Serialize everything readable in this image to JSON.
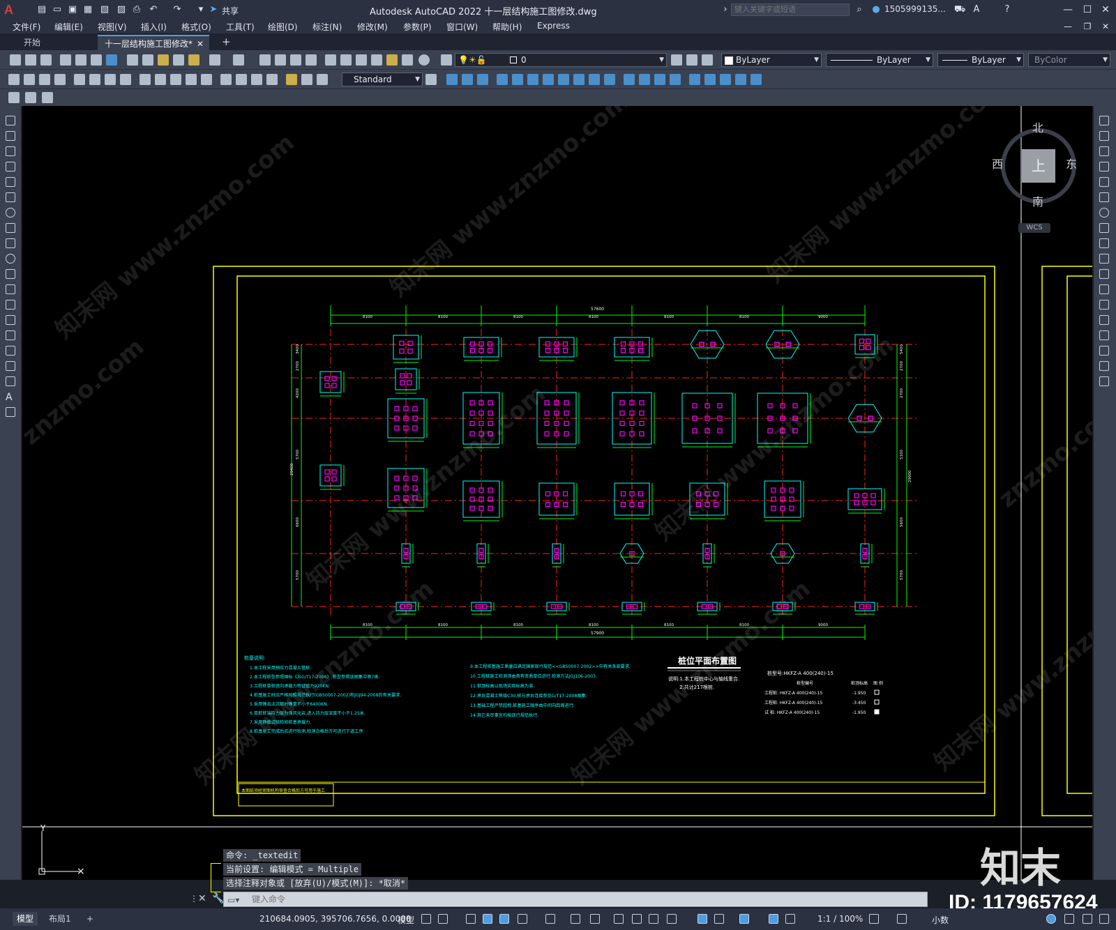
{
  "titlebar": {
    "app_logo": "A",
    "share_label": "共享",
    "title": "Autodesk AutoCAD 2022    十一层结构施工图修改.dwg",
    "search_placeholder": "键入关键字或短语",
    "user": "1505999135...",
    "icons": [
      "new-icon",
      "open-icon",
      "save-icon",
      "saveas-icon",
      "publish-icon",
      "plot-icon",
      "undo-icon",
      "redo-icon",
      "share-icon",
      "cart-icon",
      "help-icon",
      "minimize-icon",
      "maximize-icon",
      "close-icon"
    ]
  },
  "menus": [
    "文件(F)",
    "编辑(E)",
    "视图(V)",
    "插入(I)",
    "格式(O)",
    "工具(T)",
    "绘图(D)",
    "标注(N)",
    "修改(M)",
    "参数(P)",
    "窗口(W)",
    "帮助(H)",
    "Express"
  ],
  "tabs": {
    "start": "开始",
    "document": "十一层结构施工图修改*",
    "add": "+"
  },
  "properties": {
    "layer": "0",
    "color": "ByLayer",
    "linetype": "ByLayer",
    "lineweight": "ByLayer",
    "plotstyle": "ByColor",
    "dimstyle": "Standard"
  },
  "viewcube": {
    "north": "北",
    "south": "南",
    "east": "东",
    "west": "西",
    "top": "上",
    "wcs": "WCS"
  },
  "drawing": {
    "plan_title": "桩位平面布置图",
    "overall_top": "57600",
    "overall_bottom": "57900",
    "top_spans": [
      "8100",
      "8100",
      "8100",
      "8100",
      "8100",
      "8100",
      "9000"
    ],
    "bottom_spans": [
      "8100",
      "8100",
      "8100",
      "8100",
      "8100",
      "8100",
      "9000"
    ],
    "left_dims": [
      "3400",
      "2700",
      "4200",
      "5700",
      "6600",
      "5700"
    ],
    "left_total": "29400",
    "right_dims": [
      "5400",
      "2700",
      "2700",
      "5100",
      "5600",
      "5700"
    ],
    "right_total": "29900",
    "notes_title": "桩基说明:",
    "notes_left": [
      "1.本工程采用预应力混凝土管桩.",
      "2.本工程桩型参照国标《苏G/T17-2008》,桩型参照该图集中第7类.",
      "3.工程桩单桩竖向承载力特征值为920KN.",
      "4.桩基施工时应严格按照规范执行(GB50007-2002)和JGJ94-2008的有关要求.",
      "5.采用锤击法沉桩时锤重不小于6400KN.",
      "6.单桩桩端持力层为强风化岩,进入持力层深度不小于1.25米.",
      "7.采用静载试验检验桩基承载力.",
      "8.桩基施工完成后应进行检测,检测合格后方可进行下道工序."
    ],
    "notes_right": [
      "9.本工程桩基施工质量应满足国家现行规范<<GB50007-2002>>中有关条款要求.",
      "10.工程桩施工检测须由具有资质单位进行,检测方法JGJ106-2003.",
      "11.桩顶标高以现场实际标高为准.",
      "12.承台混凝土等级C30,桩与承台连接参见G/T17-2008图集.",
      "13.基础工程严禁超挖,桩基施工顺序由中间向四周进行.",
      "14.其它未尽事宜均按现行规范执行."
    ],
    "plan_notes": [
      "说明:1.本工程桩中心与轴线重合.",
      "2.共计217根桩."
    ],
    "legend_title": "桩型号:HKFZ-A 400(240)-15",
    "legend_header": [
      "桩型编号",
      "桩顶标高",
      "图 例"
    ],
    "legend_rows": [
      [
        "工程桩: HKFZ-A 400(240)-15",
        "-1.950"
      ],
      [
        "工程桩: HKFZ-A 400(240)-15",
        "-3.450"
      ],
      [
        "试 桩: HKFZ-A 400(240)-15",
        "-1.950"
      ]
    ],
    "stamp_text": "本图纸须经审图机构审查合格后方可用于施工"
  },
  "command": {
    "history": [
      "命令: _textedit",
      "当前设置: 编辑模式 = Multiple",
      "选择注释对象或 [放弃(U)/模式(M)]: *取消*"
    ],
    "placeholder": "键入命令"
  },
  "statusbar": {
    "model_tab": "模型",
    "layout_tab": "布局1",
    "add_tab": "+",
    "coords": "210684.0905, 395706.7656, 0.0000",
    "space": "模型",
    "scale": "1:1 / 100%",
    "units": "小数"
  },
  "watermark": {
    "site": "znzmo.com",
    "brand": "知末",
    "id": "ID: 1179657624",
    "cn": "知末网 www.znzmo.com"
  },
  "colors": {
    "canvas": "#000000",
    "frame": "#ffff00",
    "axis": "#ff2020",
    "dims": "#00ff00",
    "cap": "#00ffff",
    "pile": "#ff00ff",
    "text": "#00ffff"
  }
}
